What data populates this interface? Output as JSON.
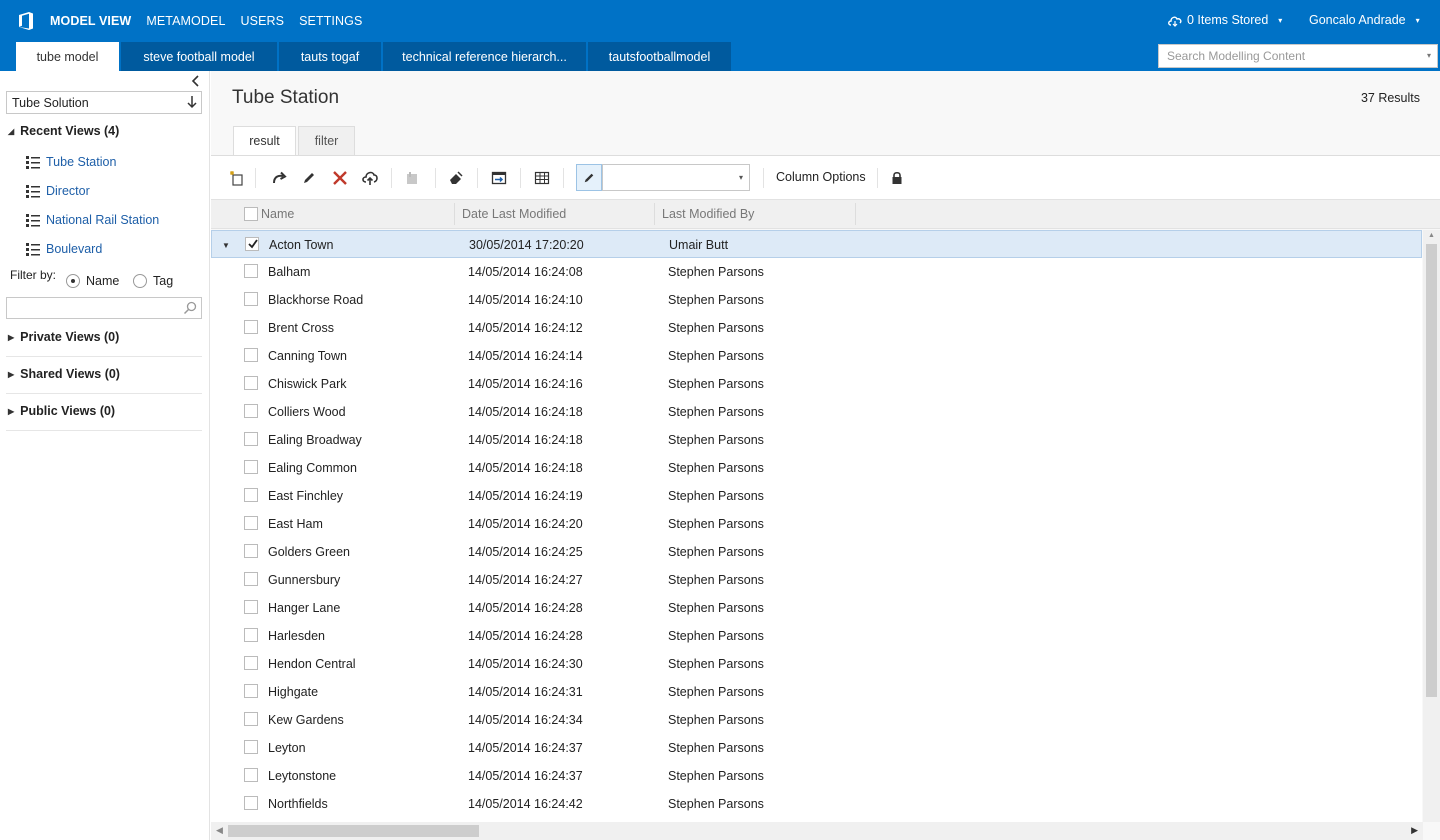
{
  "topbar": {
    "nav": [
      "MODEL VIEW",
      "METAMODEL",
      "USERS",
      "SETTINGS"
    ],
    "items_stored": "0 Items Stored",
    "user_name": "Goncalo Andrade",
    "caret": "▾"
  },
  "model_tabs": [
    "tube model",
    "steve football model",
    "tauts togaf",
    "technical reference hierarch...",
    "tautsfootballmodel"
  ],
  "search": {
    "placeholder": "Search Modelling Content"
  },
  "sidebar": {
    "solution": "Tube Solution",
    "recent_views_label": "Recent Views (4)",
    "recent_views": [
      "Tube Station",
      "Director",
      "National Rail Station",
      "Boulevard"
    ],
    "filter_by_label": "Filter by:",
    "filter_options": [
      "Name",
      "Tag"
    ],
    "filter_selected": "Name",
    "private_views_label": "Private Views (0)",
    "shared_views_label": "Shared Views (0)",
    "public_views_label": "Public Views (0)"
  },
  "main": {
    "title": "Tube Station",
    "results": "37 Results",
    "tabs": [
      "result",
      "filter"
    ],
    "column_options": "Column Options",
    "columns": [
      "Name",
      "Date Last Modified",
      "Last Modified By"
    ],
    "rows": [
      {
        "name": "Acton Town",
        "date": "30/05/2014 17:20:20",
        "by": "Umair Butt",
        "selected": true
      },
      {
        "name": "Balham",
        "date": "14/05/2014 16:24:08",
        "by": "Stephen Parsons"
      },
      {
        "name": "Blackhorse Road",
        "date": "14/05/2014 16:24:10",
        "by": "Stephen Parsons"
      },
      {
        "name": "Brent Cross",
        "date": "14/05/2014 16:24:12",
        "by": "Stephen Parsons"
      },
      {
        "name": "Canning Town",
        "date": "14/05/2014 16:24:14",
        "by": "Stephen Parsons"
      },
      {
        "name": "Chiswick Park",
        "date": "14/05/2014 16:24:16",
        "by": "Stephen Parsons"
      },
      {
        "name": "Colliers Wood",
        "date": "14/05/2014 16:24:18",
        "by": "Stephen Parsons"
      },
      {
        "name": "Ealing Broadway",
        "date": "14/05/2014 16:24:18",
        "by": "Stephen Parsons"
      },
      {
        "name": "Ealing Common",
        "date": "14/05/2014 16:24:18",
        "by": "Stephen Parsons"
      },
      {
        "name": "East Finchley",
        "date": "14/05/2014 16:24:19",
        "by": "Stephen Parsons"
      },
      {
        "name": "East Ham",
        "date": "14/05/2014 16:24:20",
        "by": "Stephen Parsons"
      },
      {
        "name": "Golders Green",
        "date": "14/05/2014 16:24:25",
        "by": "Stephen Parsons"
      },
      {
        "name": "Gunnersbury",
        "date": "14/05/2014 16:24:27",
        "by": "Stephen Parsons"
      },
      {
        "name": "Hanger Lane",
        "date": "14/05/2014 16:24:28",
        "by": "Stephen Parsons"
      },
      {
        "name": "Harlesden",
        "date": "14/05/2014 16:24:28",
        "by": "Stephen Parsons"
      },
      {
        "name": "Hendon Central",
        "date": "14/05/2014 16:24:30",
        "by": "Stephen Parsons"
      },
      {
        "name": "Highgate",
        "date": "14/05/2014 16:24:31",
        "by": "Stephen Parsons"
      },
      {
        "name": "Kew Gardens",
        "date": "14/05/2014 16:24:34",
        "by": "Stephen Parsons"
      },
      {
        "name": "Leyton",
        "date": "14/05/2014 16:24:37",
        "by": "Stephen Parsons"
      },
      {
        "name": "Leytonstone",
        "date": "14/05/2014 16:24:37",
        "by": "Stephen Parsons"
      },
      {
        "name": "Northfields",
        "date": "14/05/2014 16:24:42",
        "by": "Stephen Parsons"
      }
    ]
  },
  "colors": {
    "brand": "#0072c6",
    "tab_dark": "#005a9e",
    "link": "#1e5fa8",
    "delete_red": "#c0392b",
    "selected_row": "#ddeaf7"
  },
  "icons": [
    "office-logo-icon",
    "cloud-icon",
    "chevron-left-icon",
    "arrow-down-icon",
    "list-view-icon",
    "search-icon",
    "new-item-icon",
    "redo-icon",
    "edit-pencil-icon",
    "delete-x-icon",
    "upload-cloud-icon",
    "save-disabled-icon",
    "eraser-icon",
    "export-icon",
    "table-icon",
    "lock-icon"
  ]
}
